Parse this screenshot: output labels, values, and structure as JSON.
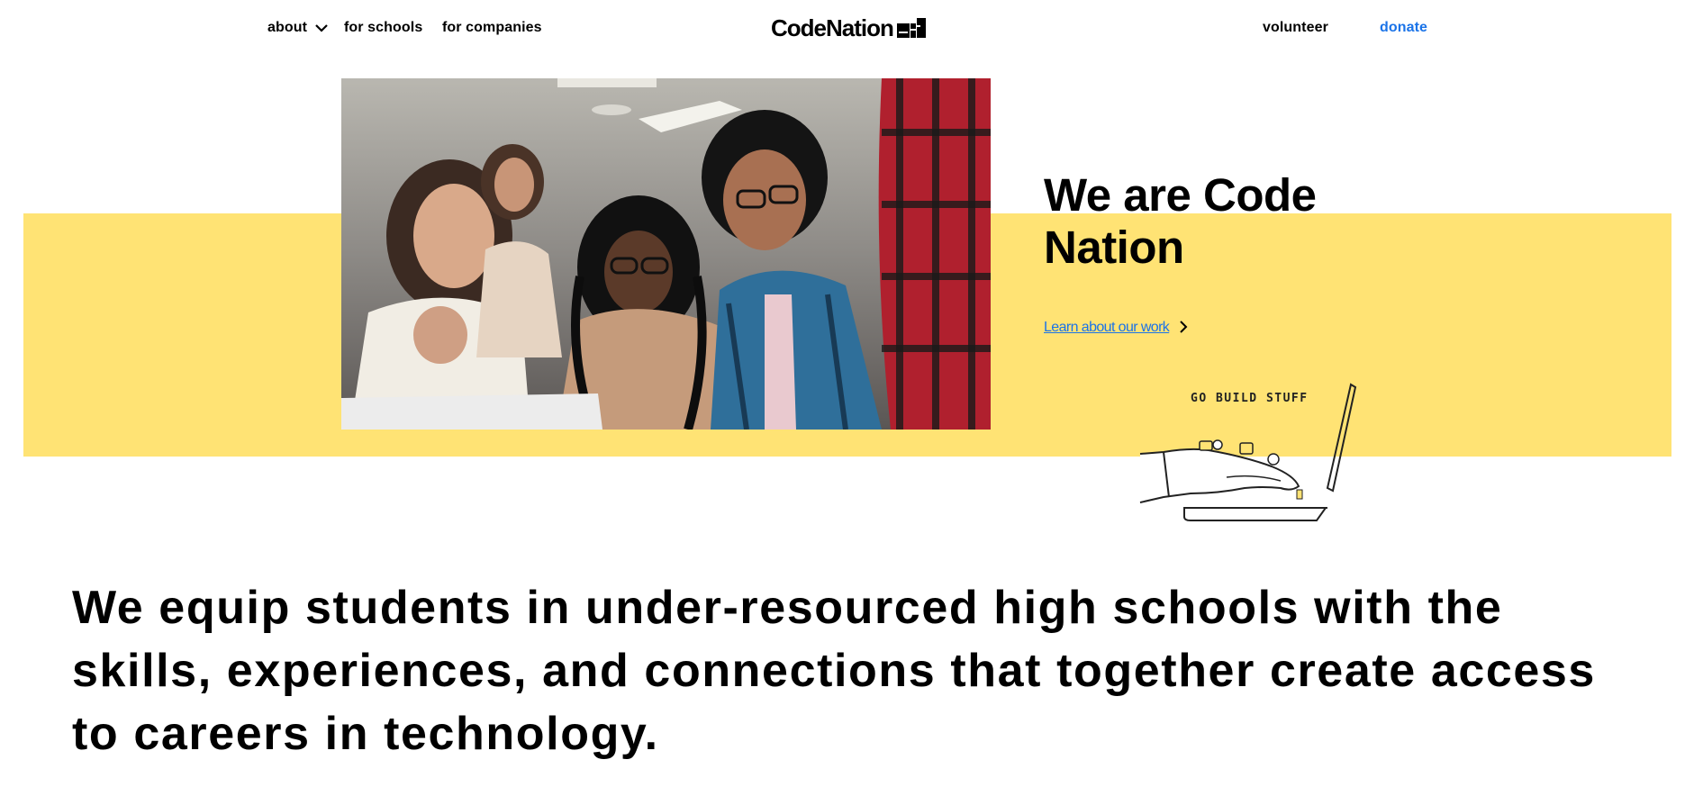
{
  "nav": {
    "about": "about",
    "for_schools": "for schools",
    "for_companies": "for companies",
    "volunteer": "volunteer",
    "donate": "donate"
  },
  "logo": {
    "text": "CodeNation"
  },
  "hero": {
    "title": "We are Code Nation",
    "link": "Learn about our work",
    "illustration_caption": "GO BUILD STUFF"
  },
  "mission": "We equip students in under-resourced high schools with the skills, experiences, and connections that together create access to careers in technology.",
  "colors": {
    "band": "#ffe374",
    "link": "#1a73e8",
    "text": "#000000"
  }
}
